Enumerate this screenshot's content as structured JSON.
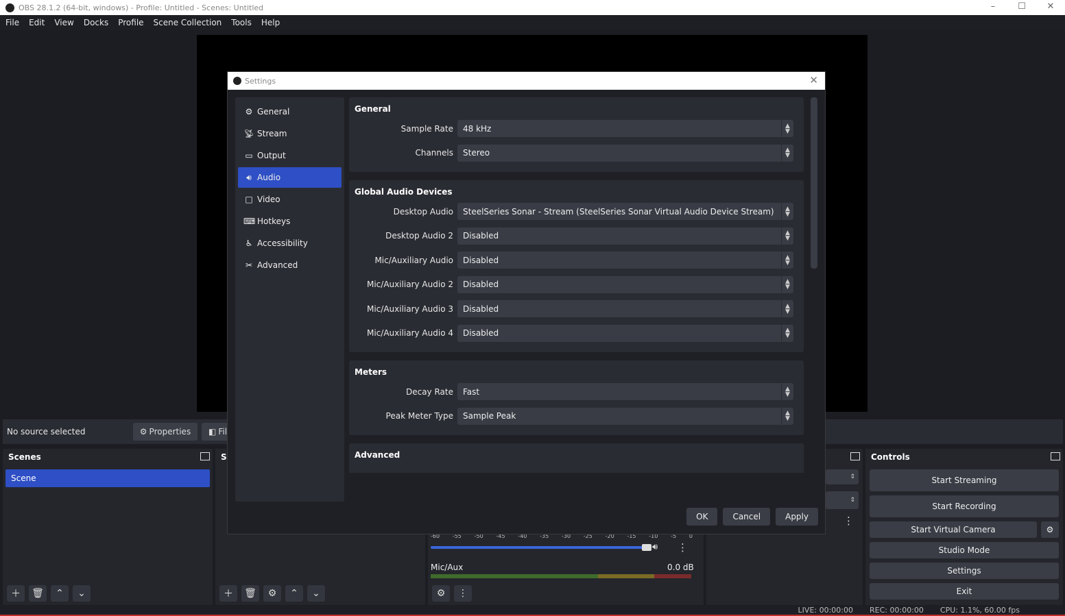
{
  "window": {
    "title": "OBS 28.1.2 (64-bit, windows) - Profile: Untitled - Scenes: Untitled",
    "minimize": "–",
    "maximize": "☐",
    "close": "✕"
  },
  "menu": [
    "File",
    "Edit",
    "View",
    "Docks",
    "Profile",
    "Scene Collection",
    "Tools",
    "Help"
  ],
  "source_bar": {
    "no_source": "No source selected",
    "properties": "Properties",
    "filters": "Filt"
  },
  "scenes": {
    "title": "Scenes",
    "items": [
      "Scene"
    ]
  },
  "sources": {
    "title": "S"
  },
  "controls": {
    "title": "Controls",
    "start_streaming": "Start Streaming",
    "start_recording": "Start Recording",
    "start_virtual_camera": "Start Virtual Camera",
    "studio_mode": "Studio Mode",
    "settings": "Settings",
    "exit": "Exit"
  },
  "mixer": {
    "ticks": [
      "-60",
      "-55",
      "-50",
      "-45",
      "-40",
      "-35",
      "-30",
      "-25",
      "-20",
      "-15",
      "-10",
      "-5",
      "0"
    ],
    "mic_label": "Mic/Aux",
    "mic_db": "0.0 dB",
    "volume_level": 0.97
  },
  "status": {
    "live": "LIVE: 00:00:00",
    "rec": "REC: 00:00:00",
    "cpu": "CPU: 1.1%, 60.00 fps"
  },
  "settings": {
    "title": "Settings",
    "nav": [
      {
        "label": "General",
        "icon": "gear-icon"
      },
      {
        "label": "Stream",
        "icon": "antenna-icon"
      },
      {
        "label": "Output",
        "icon": "output-icon"
      },
      {
        "label": "Audio",
        "icon": "speaker-icon"
      },
      {
        "label": "Video",
        "icon": "monitor-icon"
      },
      {
        "label": "Hotkeys",
        "icon": "keyboard-icon"
      },
      {
        "label": "Accessibility",
        "icon": "accessibility-icon"
      },
      {
        "label": "Advanced",
        "icon": "tools-icon"
      }
    ],
    "active_nav": "Audio",
    "general": {
      "title": "General",
      "sample_rate_label": "Sample Rate",
      "sample_rate": "48 kHz",
      "channels_label": "Channels",
      "channels": "Stereo"
    },
    "devices": {
      "title": "Global Audio Devices",
      "rows": [
        {
          "label": "Desktop Audio",
          "value": "SteelSeries Sonar - Stream (SteelSeries Sonar Virtual Audio Device Stream)"
        },
        {
          "label": "Desktop Audio 2",
          "value": "Disabled"
        },
        {
          "label": "Mic/Auxiliary Audio",
          "value": "Disabled"
        },
        {
          "label": "Mic/Auxiliary Audio 2",
          "value": "Disabled"
        },
        {
          "label": "Mic/Auxiliary Audio 3",
          "value": "Disabled"
        },
        {
          "label": "Mic/Auxiliary Audio 4",
          "value": "Disabled"
        }
      ]
    },
    "meters": {
      "title": "Meters",
      "decay_label": "Decay Rate",
      "decay": "Fast",
      "peak_label": "Peak Meter Type",
      "peak": "Sample Peak"
    },
    "advanced": {
      "title": "Advanced"
    },
    "buttons": {
      "ok": "OK",
      "cancel": "Cancel",
      "apply": "Apply"
    }
  }
}
